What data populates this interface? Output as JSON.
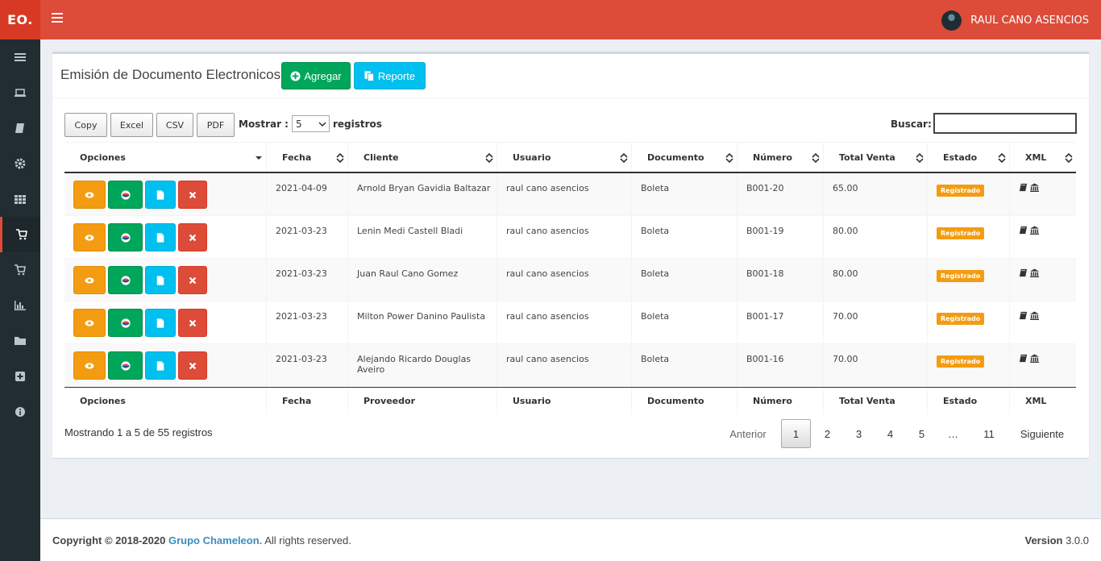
{
  "header": {
    "logo": "EO.",
    "user_name": "RAUL CANO ASENCIOS"
  },
  "sidebar": {
    "items": [
      {
        "icon": "list-icon"
      },
      {
        "icon": "laptop-icon"
      },
      {
        "icon": "book-icon"
      },
      {
        "icon": "gear-icon"
      },
      {
        "icon": "grid-icon"
      },
      {
        "icon": "cart-icon",
        "active": true
      },
      {
        "icon": "cart-icon"
      },
      {
        "icon": "bar-chart-icon"
      },
      {
        "icon": "folder-icon"
      },
      {
        "icon": "plus-square-icon"
      },
      {
        "icon": "info-icon"
      }
    ]
  },
  "box": {
    "title": "Emisión de Documento Electronicos",
    "add_label": "Agregar",
    "report_label": "Reporte"
  },
  "toolbar": {
    "copy": "Copy",
    "excel": "Excel",
    "csv": "CSV",
    "pdf": "PDF",
    "show_label": "Mostrar :",
    "show_value": "5",
    "records_label": "registros",
    "search_label": "Buscar:"
  },
  "table": {
    "headers": [
      "Opciones",
      "Fecha",
      "Cliente",
      "Usuario",
      "Documento",
      "Número",
      "Total Venta",
      "Estado",
      "XML"
    ],
    "footers": [
      "Opciones",
      "Fecha",
      "Proveedor",
      "Usuario",
      "Documento",
      "Número",
      "Total Venta",
      "Estado",
      "XML"
    ],
    "rows": [
      {
        "fecha": "2021-04-09",
        "cliente": "Arnold Bryan Gavidia Baltazar",
        "usuario": "raul cano asencios",
        "documento": "Boleta",
        "numero": "B001-20",
        "total": "65.00",
        "estado": "Registrado"
      },
      {
        "fecha": "2021-03-23",
        "cliente": "Lenin Medi Castell Bladi",
        "usuario": "raul cano asencios",
        "documento": "Boleta",
        "numero": "B001-19",
        "total": "80.00",
        "estado": "Registrado"
      },
      {
        "fecha": "2021-03-23",
        "cliente": "Juan Raul Cano Gomez",
        "usuario": "raul cano asencios",
        "documento": "Boleta",
        "numero": "B001-18",
        "total": "80.00",
        "estado": "Registrado"
      },
      {
        "fecha": "2021-03-23",
        "cliente": "Milton Power Danino Paulista",
        "usuario": "raul cano asencios",
        "documento": "Boleta",
        "numero": "B001-17",
        "total": "70.00",
        "estado": "Registrado"
      },
      {
        "fecha": "2021-03-23",
        "cliente": "Alejando Ricardo Douglas Aveiro",
        "usuario": "raul cano asencios",
        "documento": "Boleta",
        "numero": "B001-16",
        "total": "70.00",
        "estado": "Registrado"
      }
    ]
  },
  "pagination": {
    "info": "Mostrando 1 a 5 de 55 registros",
    "prev": "Anterior",
    "pages": [
      "1",
      "2",
      "3",
      "4",
      "5",
      "…",
      "11"
    ],
    "current": "1",
    "next": "Siguiente"
  },
  "footer": {
    "copyright": "Copyright © 2018-2020",
    "brand": "Grupo Chameleon.",
    "rights": "All rights reserved.",
    "version_label": "Version",
    "version_value": "3.0.0"
  },
  "colors": {
    "header": "#dd4b39",
    "sidebar": "#222d32",
    "success": "#00a65a",
    "info": "#00c0ef",
    "warning": "#f39c12",
    "danger": "#dd4b39"
  }
}
